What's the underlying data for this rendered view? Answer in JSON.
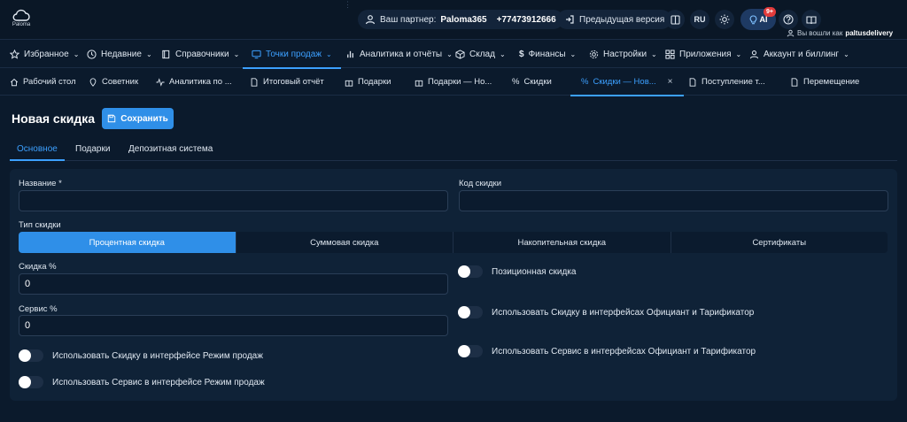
{
  "header": {
    "logo_text": "Paloma",
    "partner_label": "Ваш партнер:",
    "partner_name": "Paloma365",
    "partner_phone": "+77473912666",
    "prev_version": "Предыдущая версия",
    "lang": "RU",
    "ai_label": "AI",
    "ai_badge": "9+",
    "login_prefix": "Вы вошли как",
    "login_user": "paltusdelivery"
  },
  "menu": [
    {
      "label": "Избранное",
      "icon": "star-icon"
    },
    {
      "label": "Недавние",
      "icon": "clock-icon"
    },
    {
      "label": "Справочники",
      "icon": "book-icon"
    },
    {
      "label": "Точки продаж",
      "icon": "monitor-icon",
      "active": true
    },
    {
      "label": "Аналитика и отчёты",
      "icon": "bar-chart-icon"
    },
    {
      "label": "Склад",
      "icon": "box-icon"
    },
    {
      "label": "Финансы",
      "icon": "dollar-icon"
    },
    {
      "label": "Настройки",
      "icon": "gear-icon"
    },
    {
      "label": "Приложения",
      "icon": "grid-icon"
    },
    {
      "label": "Аккаунт и биллинг",
      "icon": "user-icon"
    }
  ],
  "tabs": [
    {
      "label": "Рабочий стол"
    },
    {
      "label": "Советник"
    },
    {
      "label": "Аналитика по ..."
    },
    {
      "label": "Итоговый отчёт"
    },
    {
      "label": "Подарки"
    },
    {
      "label": "Подарки — Но..."
    },
    {
      "label": "Скидки"
    },
    {
      "label": "Скидки — Нов...",
      "active": true,
      "close": "×"
    },
    {
      "label": "Поступление т..."
    },
    {
      "label": "Перемещение"
    }
  ],
  "page": {
    "title": "Новая скидка",
    "save": "Сохранить"
  },
  "subtabs": [
    "Основное",
    "Подарки",
    "Депозитная система"
  ],
  "form": {
    "name_label": "Название *",
    "name_value": "",
    "code_label": "Код скидки",
    "code_value": "",
    "type_label": "Тип скидки",
    "types": [
      "Процентная скидка",
      "Суммовая скидка",
      "Накопительная скидка",
      "Сертификаты"
    ],
    "discount_label": "Скидка %",
    "discount_value": "0",
    "service_label": "Сервис %",
    "service_value": "0",
    "toggles": {
      "positional": "Позиционная скидка",
      "discount_waiter": "Использовать Скидку в интерфейсах Официант и Тарификатор",
      "service_waiter": "Использовать Сервис в интерфейсах Официант и Тарификатор",
      "discount_sales": "Использовать Скидку в интерфейсе Режим продаж",
      "service_sales": "Использовать Сервис в интерфейсе Режим продаж"
    }
  },
  "colors": {
    "accent": "#2f8fe8",
    "active_text": "#3ca0ff",
    "background": "#0b1a2c",
    "card": "#0f2237"
  }
}
